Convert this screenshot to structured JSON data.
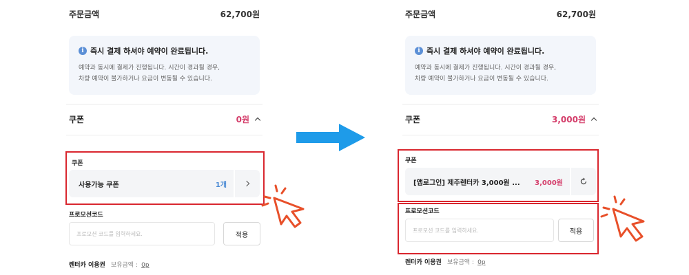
{
  "panels": {
    "before": {
      "order_label": "주문금액",
      "order_amount": "62,700원",
      "notice_title": "즉시 결제 하셔야 예약이 완료됩니다.",
      "notice_line1": "예약과 동시에 결제가 진행됩니다. 시간이 경과될 경우,",
      "notice_line2": "차량 예약이 불가하거나 요금이 변동될 수 있습니다.",
      "coupon_title": "쿠폰",
      "coupon_amount": "0원",
      "coupon_label": "쿠폰",
      "coupon_name": "사용가능 쿠폰",
      "coupon_count": "1개",
      "promo_label": "프로모션코드",
      "promo_placeholder": "프로모션 코드를 입력하세요.",
      "apply_label": "적용",
      "rental_label": "렌터카 이용권",
      "balance_label": "보유금액 :",
      "balance_value": "0p"
    },
    "after": {
      "order_label": "주문금액",
      "order_amount": "62,700원",
      "notice_title": "즉시 결제 하셔야 예약이 완료됩니다.",
      "notice_line1": "예약과 동시에 결제가 진행됩니다. 시간이 경과될 경우,",
      "notice_line2": "차량 예약이 불가하거나 요금이 변동될 수 있습니다.",
      "coupon_title": "쿠폰",
      "coupon_amount": "3,000원",
      "coupon_label": "쿠폰",
      "coupon_name": "[앱로그인] 제주렌터카 3,000원 ...",
      "coupon_price": "3,000원",
      "promo_label": "프로모션코드",
      "promo_placeholder": "프로모션 코드를 입력하세요.",
      "apply_label": "적용",
      "rental_label": "렌터카 이용권",
      "balance_label": "보유금액 :",
      "balance_value": "0p"
    }
  },
  "icons": {
    "info": "info-icon",
    "chevron_up": "chevron-up-icon",
    "chevron_right": "chevron-right-icon",
    "reset": "reset-icon",
    "arrow": "arrow-right-icon",
    "cursor": "pointer-hand-icon"
  },
  "colors": {
    "accent_pink": "#d43d6a",
    "accent_blue": "#4a8ad4",
    "highlight_red": "#d9262e",
    "arrow_blue": "#1e9be9",
    "notice_bg": "#f3f6fb"
  }
}
